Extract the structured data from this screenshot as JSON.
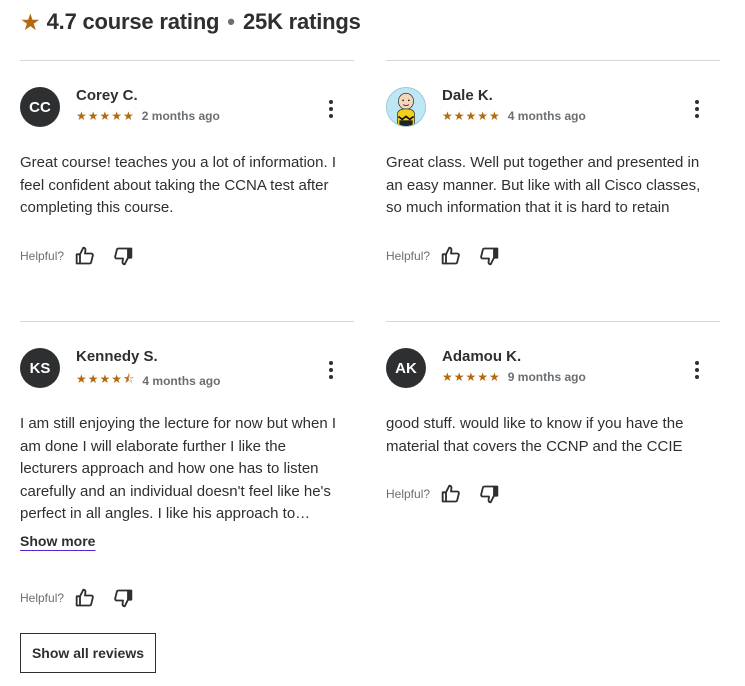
{
  "header": {
    "rating_text": "4.7 course rating",
    "separator": "•",
    "count_text": "25K ratings",
    "icon": "star-icon"
  },
  "colors": {
    "star": "#b4690e",
    "text": "#2d2f31",
    "muted": "#6a6f73",
    "divider": "#d1d7dc",
    "link_underline": "#5624d0"
  },
  "reviews": [
    {
      "initials": "CC",
      "name": "Corey C.",
      "rating": 5,
      "stars_text": "★★★★★",
      "date": "2 months ago",
      "text": "Great course! teaches you a lot of information. I feel confident about taking the CCNA test after completing this course.",
      "helpful_label": "Helpful?"
    },
    {
      "initials": "",
      "avatar_icon": "character-avatar-icon",
      "name": "Dale K.",
      "rating": 5,
      "stars_text": "★★★★★",
      "date": "4 months ago",
      "text": "Great class. Well put together and presented in an easy manner. But like with all Cisco classes, so much information that it is hard to retain",
      "helpful_label": "Helpful?"
    },
    {
      "initials": "KS",
      "name": "Kennedy S.",
      "rating": 4.5,
      "stars_text": "★★★★⯪",
      "date": "4 months ago",
      "text": "I am still enjoying the lecture for now but when I am done I will elaborate further I like the lecturers approach and how one has to listen carefully and an individual doesn't feel like he's perfect in all angles. I like his approach to…",
      "show_more": "Show more",
      "helpful_label": "Helpful?"
    },
    {
      "initials": "AK",
      "name": "Adamou K.",
      "rating": 5,
      "stars_text": "★★★★★",
      "date": "9 months ago",
      "text": "good stuff. would like to know if you have the material that covers the CCNP and the CCIE",
      "helpful_label": "Helpful?"
    }
  ],
  "show_all_label": "Show all reviews"
}
